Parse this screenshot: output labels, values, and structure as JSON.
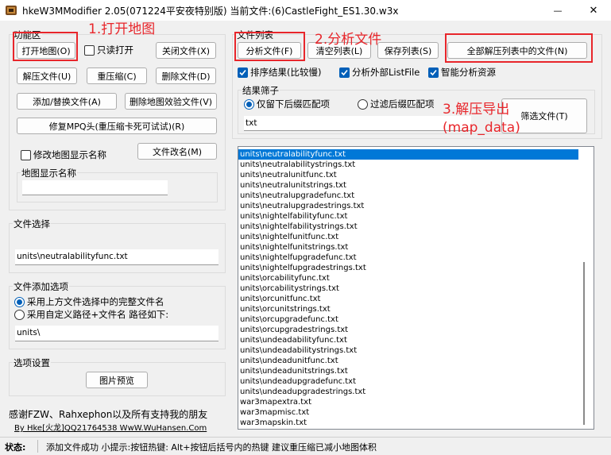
{
  "window": {
    "title": "hkeW3MModifier 2.05(071224平安夜特别版) 当前文件:(6)CastleFight_ES1.30.w3x",
    "minimize_glyph": "—",
    "close_glyph": "✕"
  },
  "function_area": {
    "label": "功能区",
    "open_map_button": "打开地图(O)",
    "read_only_label": "只读打开",
    "close_file_button": "关闭文件(X)",
    "decompress_button": "解压文件(U)",
    "recompress_button": "重压缩(C)",
    "delete_file_button": "删除文件(D)",
    "add_replace_button": "添加/替换文件(A)",
    "delete_verify_button": "删除地图效验文件(V)",
    "repair_mpq_button": "修复MPQ头(重压缩卡死可试试)(R)",
    "modify_name_label": "修改地图显示名称",
    "rename_button": "文件改名(M)",
    "map_name_label": "地图显示名称",
    "map_name_value": ""
  },
  "file_select": {
    "label": "文件选择",
    "value": "units\\neutralabilityfunc.txt"
  },
  "add_options": {
    "label": "文件添加选项",
    "option1": "采用上方文件选择中的完整文件名",
    "option2": "采用自定义路径+文件名 路径如下:",
    "path_value": "units\\"
  },
  "option_settings": {
    "label": "选项设置",
    "preview_button": "图片预览"
  },
  "credits": {
    "line1": "感谢FZW、Rahxephon以及所有支持我的朋友",
    "line2": "By Hke[火龙]QQ21764538 WwW.WuHansen.Com"
  },
  "file_list": {
    "label": "文件列表",
    "analyze_button": "分析文件(F)",
    "clear_button": "清空列表(L)",
    "save_button": "保存列表(S)",
    "extract_all_button": "全部解压列表中的文件(N)",
    "sort_label": "排序结果(比较慢)",
    "analyze_external_label": "分析外部ListFile",
    "smart_analyze_label": "智能分析资源",
    "filter_label": "结果筛子",
    "keep_suffix_label": "仅留下后缀匹配项",
    "filter_suffix_label": "过滤后缀匹配项",
    "filter_value": "txt",
    "filter_button": "筛选文件(T)",
    "items": [
      "units\\neutralabilityfunc.txt",
      "units\\neutralabilitystrings.txt",
      "units\\neutralunitfunc.txt",
      "units\\neutralunitstrings.txt",
      "units\\neutralupgradefunc.txt",
      "units\\neutralupgradestrings.txt",
      "units\\nightelfabilityfunc.txt",
      "units\\nightelfabilitystrings.txt",
      "units\\nightelfunitfunc.txt",
      "units\\nightelfunitstrings.txt",
      "units\\nightelfupgradefunc.txt",
      "units\\nightelfupgradestrings.txt",
      "units\\orcabilityfunc.txt",
      "units\\orcabilitystrings.txt",
      "units\\orcunitfunc.txt",
      "units\\orcunitstrings.txt",
      "units\\orcupgradefunc.txt",
      "units\\orcupgradestrings.txt",
      "units\\undeadabilityfunc.txt",
      "units\\undeadabilitystrings.txt",
      "units\\undeadunitfunc.txt",
      "units\\undeadunitstrings.txt",
      "units\\undeadupgradefunc.txt",
      "units\\undeadupgradestrings.txt",
      "war3mapextra.txt",
      "war3mapmisc.txt",
      "war3mapskin.txt"
    ]
  },
  "annotations": {
    "step1": "1.打开地图",
    "step2": "2.分析文件",
    "step3_line1": "3.解压导出",
    "step3_line2": "(map_data)"
  },
  "status": {
    "label": "状态:",
    "text": "添加文件成功 小提示:按钮热键: Alt+按钮后括号内的热键 建议重压缩已减小地图体积"
  },
  "colors": {
    "accent": "#0078d7",
    "annotation_red": "#e8262b",
    "checkbox_blue": "#005fb8"
  }
}
